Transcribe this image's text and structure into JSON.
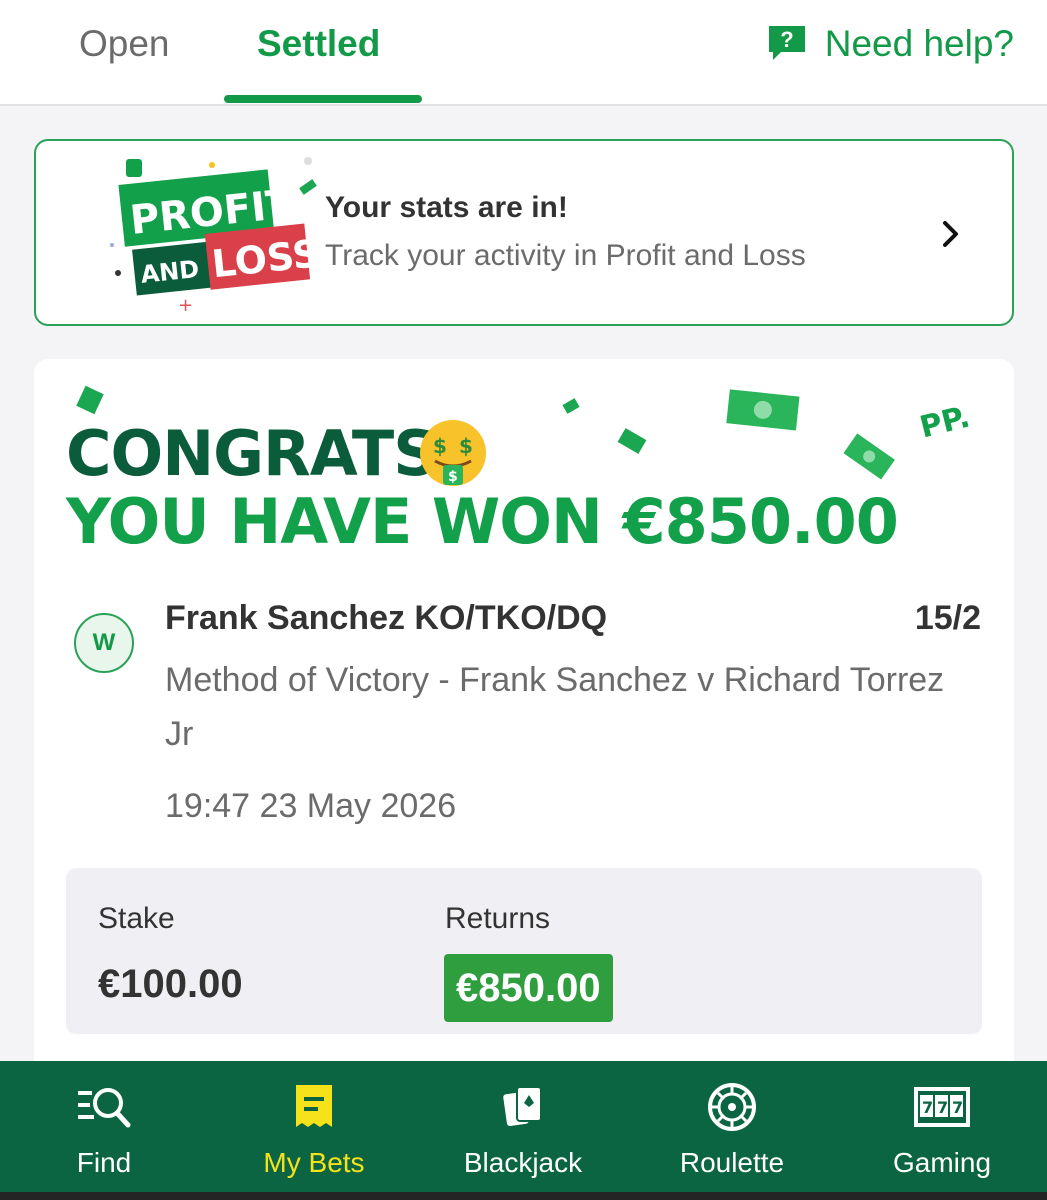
{
  "tabs": {
    "open": "Open",
    "settled": "Settled",
    "active": "Settled"
  },
  "help": {
    "label": "Need help?",
    "icon": "question-chat-icon"
  },
  "promo": {
    "logo_line1": "PROFIT",
    "logo_line2": "AND",
    "logo_line3": "LOSS",
    "title": "Your stats are in!",
    "subtitle": "Track your activity in Profit and Loss",
    "icon": "chevron-right-icon"
  },
  "bet": {
    "congrats": "CONGRATS!",
    "won_line": "YOU HAVE WON €850.00",
    "brand_mark": "PP.",
    "result_badge": "W",
    "selection": "Frank Sanchez KO/TKO/DQ",
    "odds": "15/2",
    "market": "Method of Victory - Frank Sanchez v Richard Torrez Jr",
    "datetime": "19:47 23 May 2026",
    "stake_label": "Stake",
    "stake_value": "€100.00",
    "returns_label": "Returns",
    "returns_value": "€850.00"
  },
  "nav": {
    "active": "My Bets",
    "items": [
      {
        "label": "Find",
        "icon": "search-list-icon"
      },
      {
        "label": "My Bets",
        "icon": "bet-slip-icon"
      },
      {
        "label": "Blackjack",
        "icon": "cards-icon"
      },
      {
        "label": "Roulette",
        "icon": "roulette-wheel-icon"
      },
      {
        "label": "Gaming",
        "icon": "slot-machine-icon"
      }
    ]
  },
  "colors": {
    "brand_green": "#129a48",
    "dark_green": "#0b5c3a",
    "nav_green": "#0b6542",
    "active_yellow": "#f6e21b",
    "returns_green": "#2f9e3e"
  }
}
